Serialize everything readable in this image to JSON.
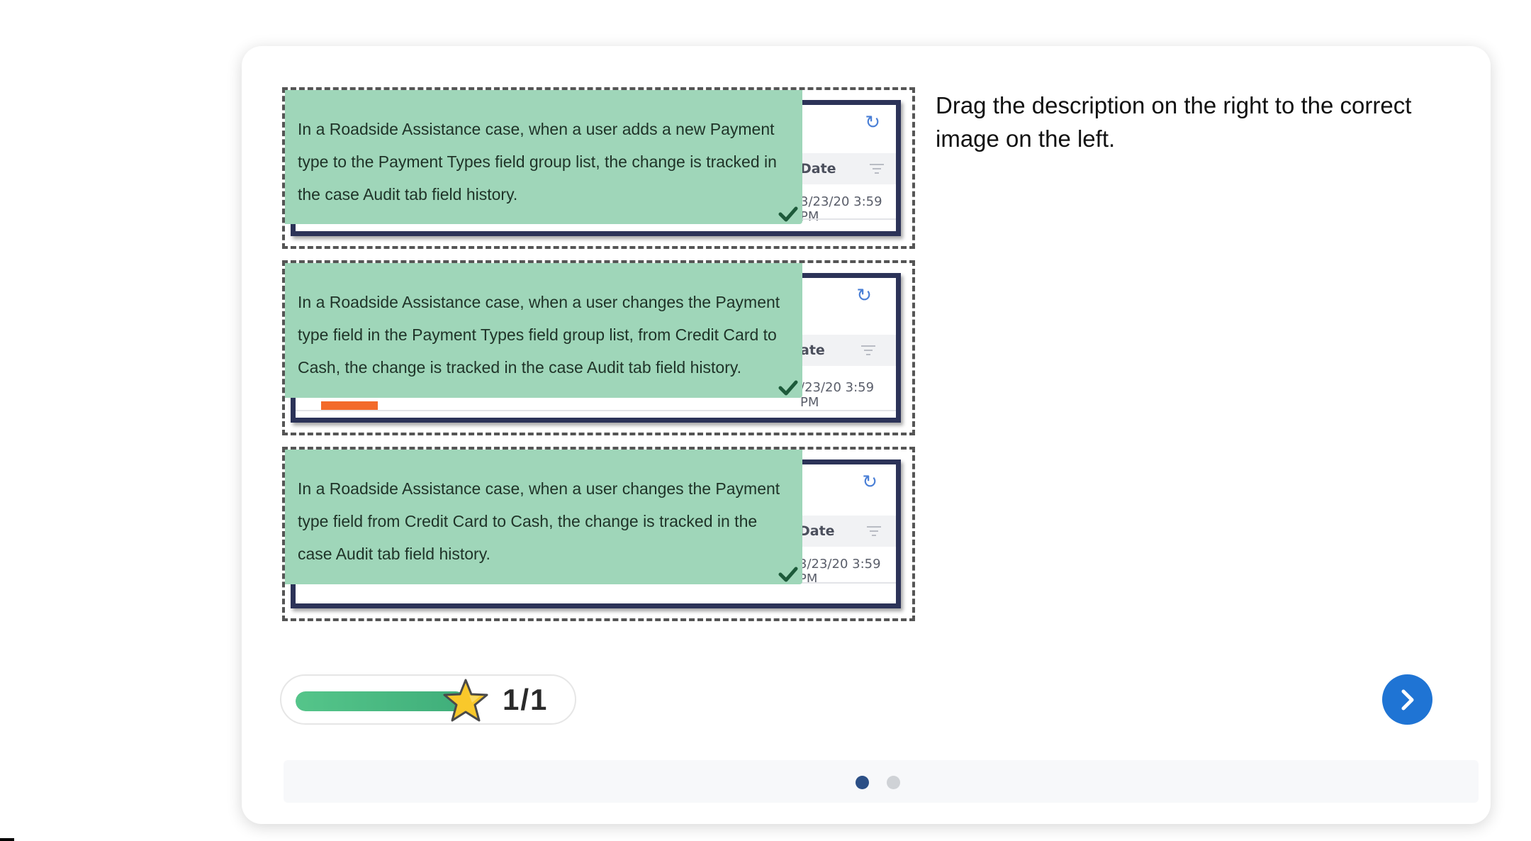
{
  "instruction": "Drag the description on the right to the correct image on the left.",
  "drop_zones": [
    {
      "description": "In a Roadside Assistance case, when a user adds a new Payment type to the Payment Types field group list, the change is tracked in the case Audit tab field history.",
      "screenshot": {
        "column_header": "Date",
        "value": "3/23/20 3:59 PM"
      }
    },
    {
      "description": "In a Roadside Assistance case, when a user changes the Payment type field in the Payment Types field group list, from Credit Card to Cash, the change is tracked in the case Audit tab field history.",
      "screenshot": {
        "column_header": "ate",
        "value": "/23/20 3:59 PM"
      }
    },
    {
      "description": "In a Roadside Assistance case, when a user changes the Payment type field from Credit Card to Cash, the change is tracked in the case Audit tab field history.",
      "screenshot": {
        "column_header": "Date",
        "value": "3/23/20 3:59 PM"
      }
    }
  ],
  "progress": {
    "score": "1/1",
    "fraction": 1.0
  },
  "pagination": {
    "total": 2,
    "current": 1
  },
  "colors": {
    "card_green": "#9fd6b9",
    "check_green": "#1d5a3a",
    "next_button_blue": "#1f74d4",
    "progress_green": "#3fae7a",
    "star_yellow": "#f9c82b",
    "active_dot": "#2b4f86"
  },
  "icons": {
    "refresh": "refresh-icon",
    "filter": "filter-icon",
    "check": "check-icon",
    "star": "star-icon",
    "next": "chevron-right-icon"
  }
}
